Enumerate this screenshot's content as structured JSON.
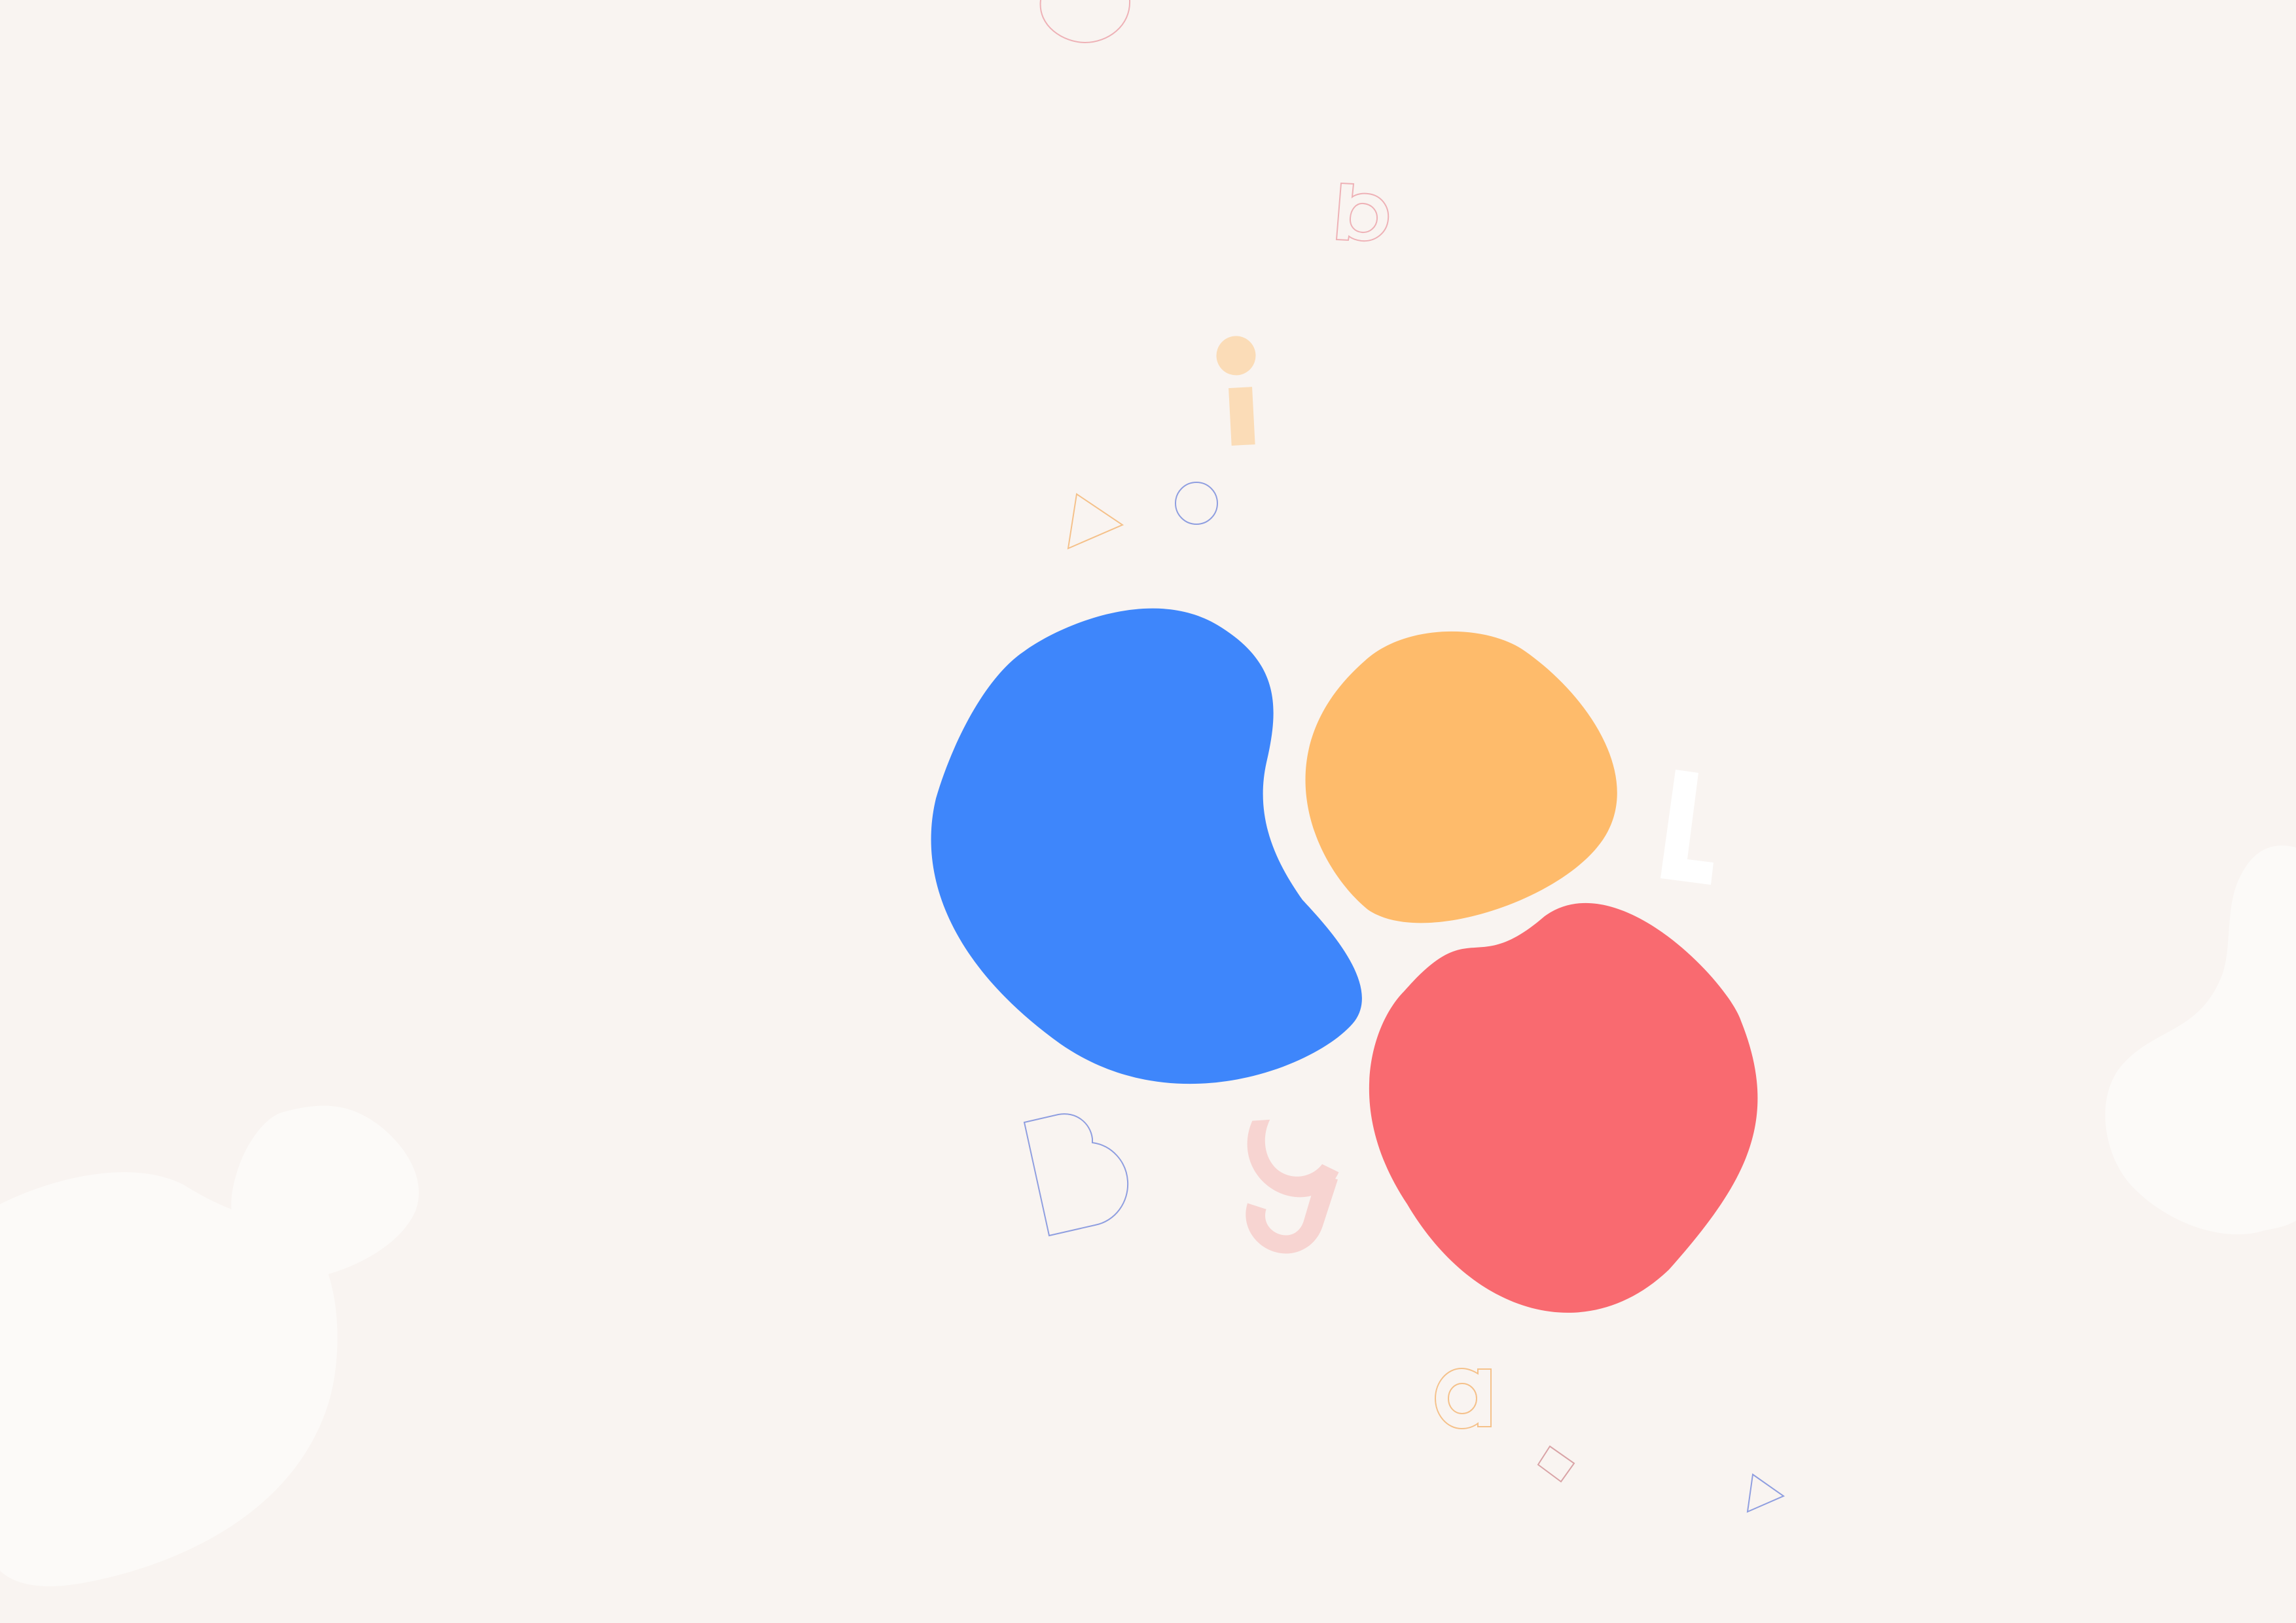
{
  "palette": {
    "background": "#f9f4f1",
    "blue": "#3e86fb",
    "orange": "#febb6b",
    "red": "#f96a70",
    "white_blob": "#fcfaf8",
    "peach": "#fbdcb7",
    "pink_light": "#f7d4d1",
    "pink_outline": "#eeb1b6",
    "orange_outline": "#f5c18a",
    "blue_outline": "#8f9ee0",
    "white": "#ffffff"
  },
  "letters": {
    "i": "i",
    "b": "b",
    "L": "L",
    "a": "a",
    "g": "g",
    "D": "D"
  }
}
